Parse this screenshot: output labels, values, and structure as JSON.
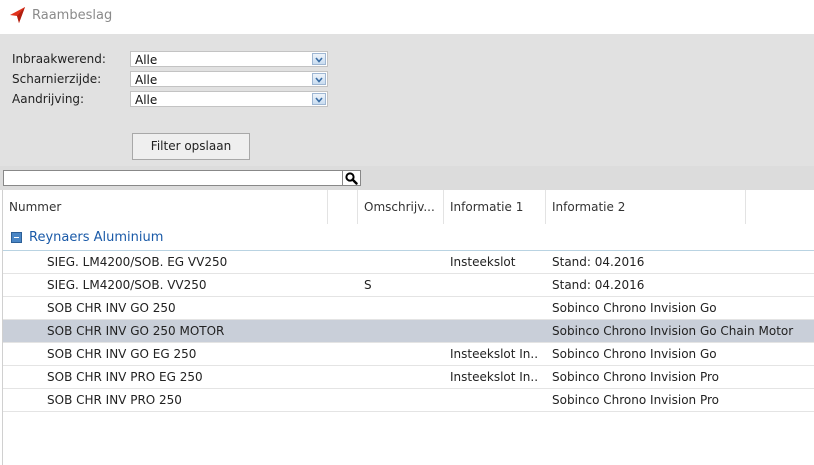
{
  "window": {
    "title": "Raambeslag",
    "icon": "red-arrow-icon"
  },
  "filters": [
    {
      "label": "Inbraakwerend:",
      "value": "Alle"
    },
    {
      "label": "Scharnierzijde:",
      "value": "Alle"
    },
    {
      "label": "Aandrijving:",
      "value": "Alle"
    }
  ],
  "save_button": "Filter opslaan",
  "search": {
    "value": "",
    "icon": "search-icon"
  },
  "columns": [
    "Nummer",
    "",
    "Omschrijv...",
    "Informatie 1",
    "Informatie 2"
  ],
  "group": {
    "name": "Reynaers Aluminium",
    "expanded": true
  },
  "rows": [
    {
      "nummer": "SIEG. LM4200/SOB. EG VV250",
      "omschrijving": "",
      "info1": "Insteekslot",
      "info2": "Stand: 04.2016",
      "selected": false
    },
    {
      "nummer": "SIEG. LM4200/SOB. VV250",
      "omschrijving": "S",
      "info1": "",
      "info2": "Stand: 04.2016",
      "selected": false
    },
    {
      "nummer": "SOB CHR INV GO 250",
      "omschrijving": "",
      "info1": "",
      "info2": "Sobinco Chrono Invision Go",
      "selected": false
    },
    {
      "nummer": "SOB CHR INV GO 250 MOTOR",
      "omschrijving": "",
      "info1": "",
      "info2": "Sobinco Chrono Invision Go Chain Motor",
      "selected": true
    },
    {
      "nummer": "SOB CHR INV GO EG 250",
      "omschrijving": "",
      "info1": "Insteekslot In...",
      "info2": "Sobinco Chrono Invision Go",
      "selected": false
    },
    {
      "nummer": "SOB CHR INV PRO EG 250",
      "omschrijving": "",
      "info1": "Insteekslot In...",
      "info2": "Sobinco Chrono Invision Pro",
      "selected": false
    },
    {
      "nummer": "SOB CHR INV PRO 250",
      "omschrijving": "",
      "info1": "",
      "info2": "Sobinco Chrono Invision Pro",
      "selected": false
    }
  ],
  "colors": {
    "accent": "#1a5aa8",
    "selected_row": "#c9cfd9",
    "panel": "#e1e1e1"
  }
}
